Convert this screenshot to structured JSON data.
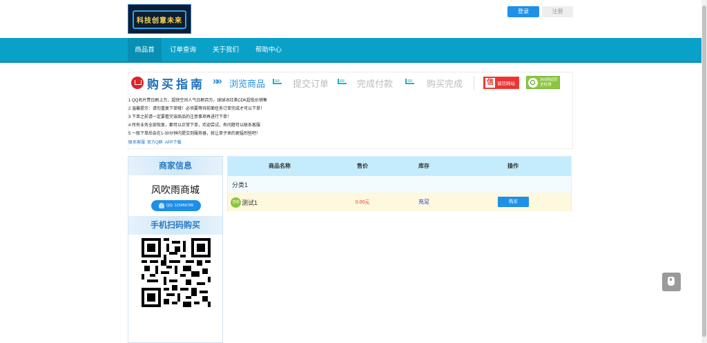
{
  "header": {
    "logo_text": "科技创意未来",
    "login_label": "登录",
    "register_label": "注册"
  },
  "nav": {
    "items": [
      "商品首页",
      "订单查询",
      "关于我们",
      "帮助中心"
    ],
    "active_index": 0
  },
  "guide": {
    "title": "购买指南",
    "steps": [
      "浏览商品",
      "提交订单",
      "完成付款",
      "购买完成"
    ],
    "badge_credit": "诚信网站",
    "badge_360": "360网站安全检测",
    "notes": [
      "1 QQ名片赞日刷上万，超快空间人气日刷百万，球球冰红茶CDK超低价销售",
      "2 温馨提示：请勿重复下单哦！必须要等待前面任务订单完成才可以下单！",
      "3 下单之前请一定要看完该商品的注意事项再进行下单！",
      "4 所有业务全部恢复，都可以正常下单，欢迎尝试，有问题可以联系客服",
      "5 一般下单后会在1-30分钟内提交到服务器，就让单子来的更猛烈些吧！"
    ],
    "links": [
      "联系客服",
      "官方Q群",
      "APP下载"
    ]
  },
  "sidebar": {
    "merchant_header": "商家信息",
    "shop_name": "风吹雨商城",
    "qq_label": "QQ: 123456789",
    "scan_header": "手机扫码购买"
  },
  "table": {
    "headers": [
      "商品名称",
      "售价",
      "库存",
      "操作"
    ],
    "category": "分类1",
    "products": [
      {
        "tag": "自动",
        "name": "测试1",
        "price": "0.00元",
        "stock": "充足",
        "action": "购买"
      }
    ]
  },
  "colors": {
    "nav_bg": "#0aa1c8",
    "primary_button": "#1e90e8",
    "price": "#e33333",
    "stock": "#1a2fcf",
    "table_header": "#c4ecfd"
  }
}
